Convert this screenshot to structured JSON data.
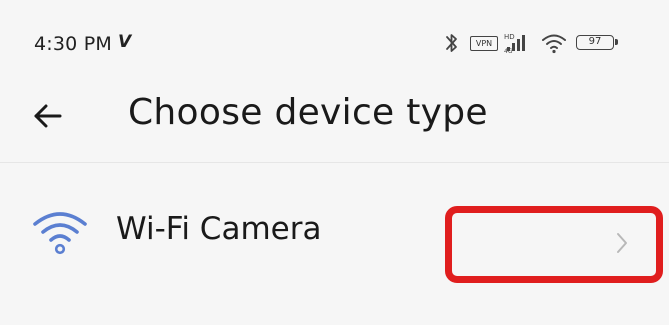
{
  "status_bar": {
    "time": "4:30 PM",
    "carrier_mark": "V",
    "vpn_label": "VPN",
    "battery_level": "97",
    "icons": [
      "bluetooth-icon",
      "vpn-icon",
      "cellular-signal-icon",
      "wifi-signal-icon",
      "battery-icon"
    ]
  },
  "header": {
    "title": "Choose device type",
    "back_icon": "back-arrow-icon"
  },
  "device_list": [
    {
      "label": "Wi-Fi Camera",
      "icon": "wifi-icon",
      "trailing_icon": "chevron-right-icon"
    }
  ],
  "colors": {
    "background": "#f6f6f6",
    "wifi_icon": "#5b7fd1",
    "highlight_border": "#e01e1e",
    "text_primary": "#1a1a1a",
    "chevron": "#b8b8b8"
  }
}
